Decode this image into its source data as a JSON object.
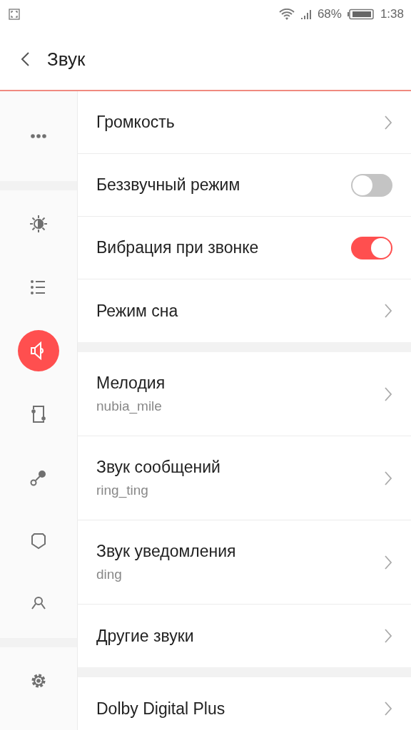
{
  "status_bar": {
    "battery": "68%",
    "time": "1:38"
  },
  "header": {
    "title": "Звук"
  },
  "sidebar": {
    "groups": [
      [
        {
          "kind": "more",
          "selected": false
        }
      ],
      [
        {
          "kind": "brightness",
          "selected": false
        },
        {
          "kind": "list",
          "selected": false
        },
        {
          "kind": "sound",
          "selected": true
        },
        {
          "kind": "frame",
          "selected": false
        },
        {
          "kind": "link",
          "selected": false
        },
        {
          "kind": "shield",
          "selected": false
        },
        {
          "kind": "person",
          "selected": false
        }
      ],
      [
        {
          "kind": "gear",
          "selected": false
        }
      ]
    ]
  },
  "groups": [
    [
      {
        "kind": "nav",
        "label": "Громкость"
      },
      {
        "kind": "toggle",
        "label": "Беззвучный режим",
        "on": false
      },
      {
        "kind": "toggle",
        "label": "Вибрация при звонке",
        "on": true
      },
      {
        "kind": "nav",
        "label": "Режим сна"
      }
    ],
    [
      {
        "kind": "nav",
        "label": "Мелодия",
        "value": "nubia_mile"
      },
      {
        "kind": "nav",
        "label": "Звук сообщений",
        "value": "ring_ting"
      },
      {
        "kind": "nav",
        "label": "Звук уведомления",
        "value": "ding"
      },
      {
        "kind": "nav",
        "label": "Другие звуки"
      }
    ],
    [
      {
        "kind": "nav",
        "label": "Dolby Digital Plus"
      }
    ]
  ]
}
